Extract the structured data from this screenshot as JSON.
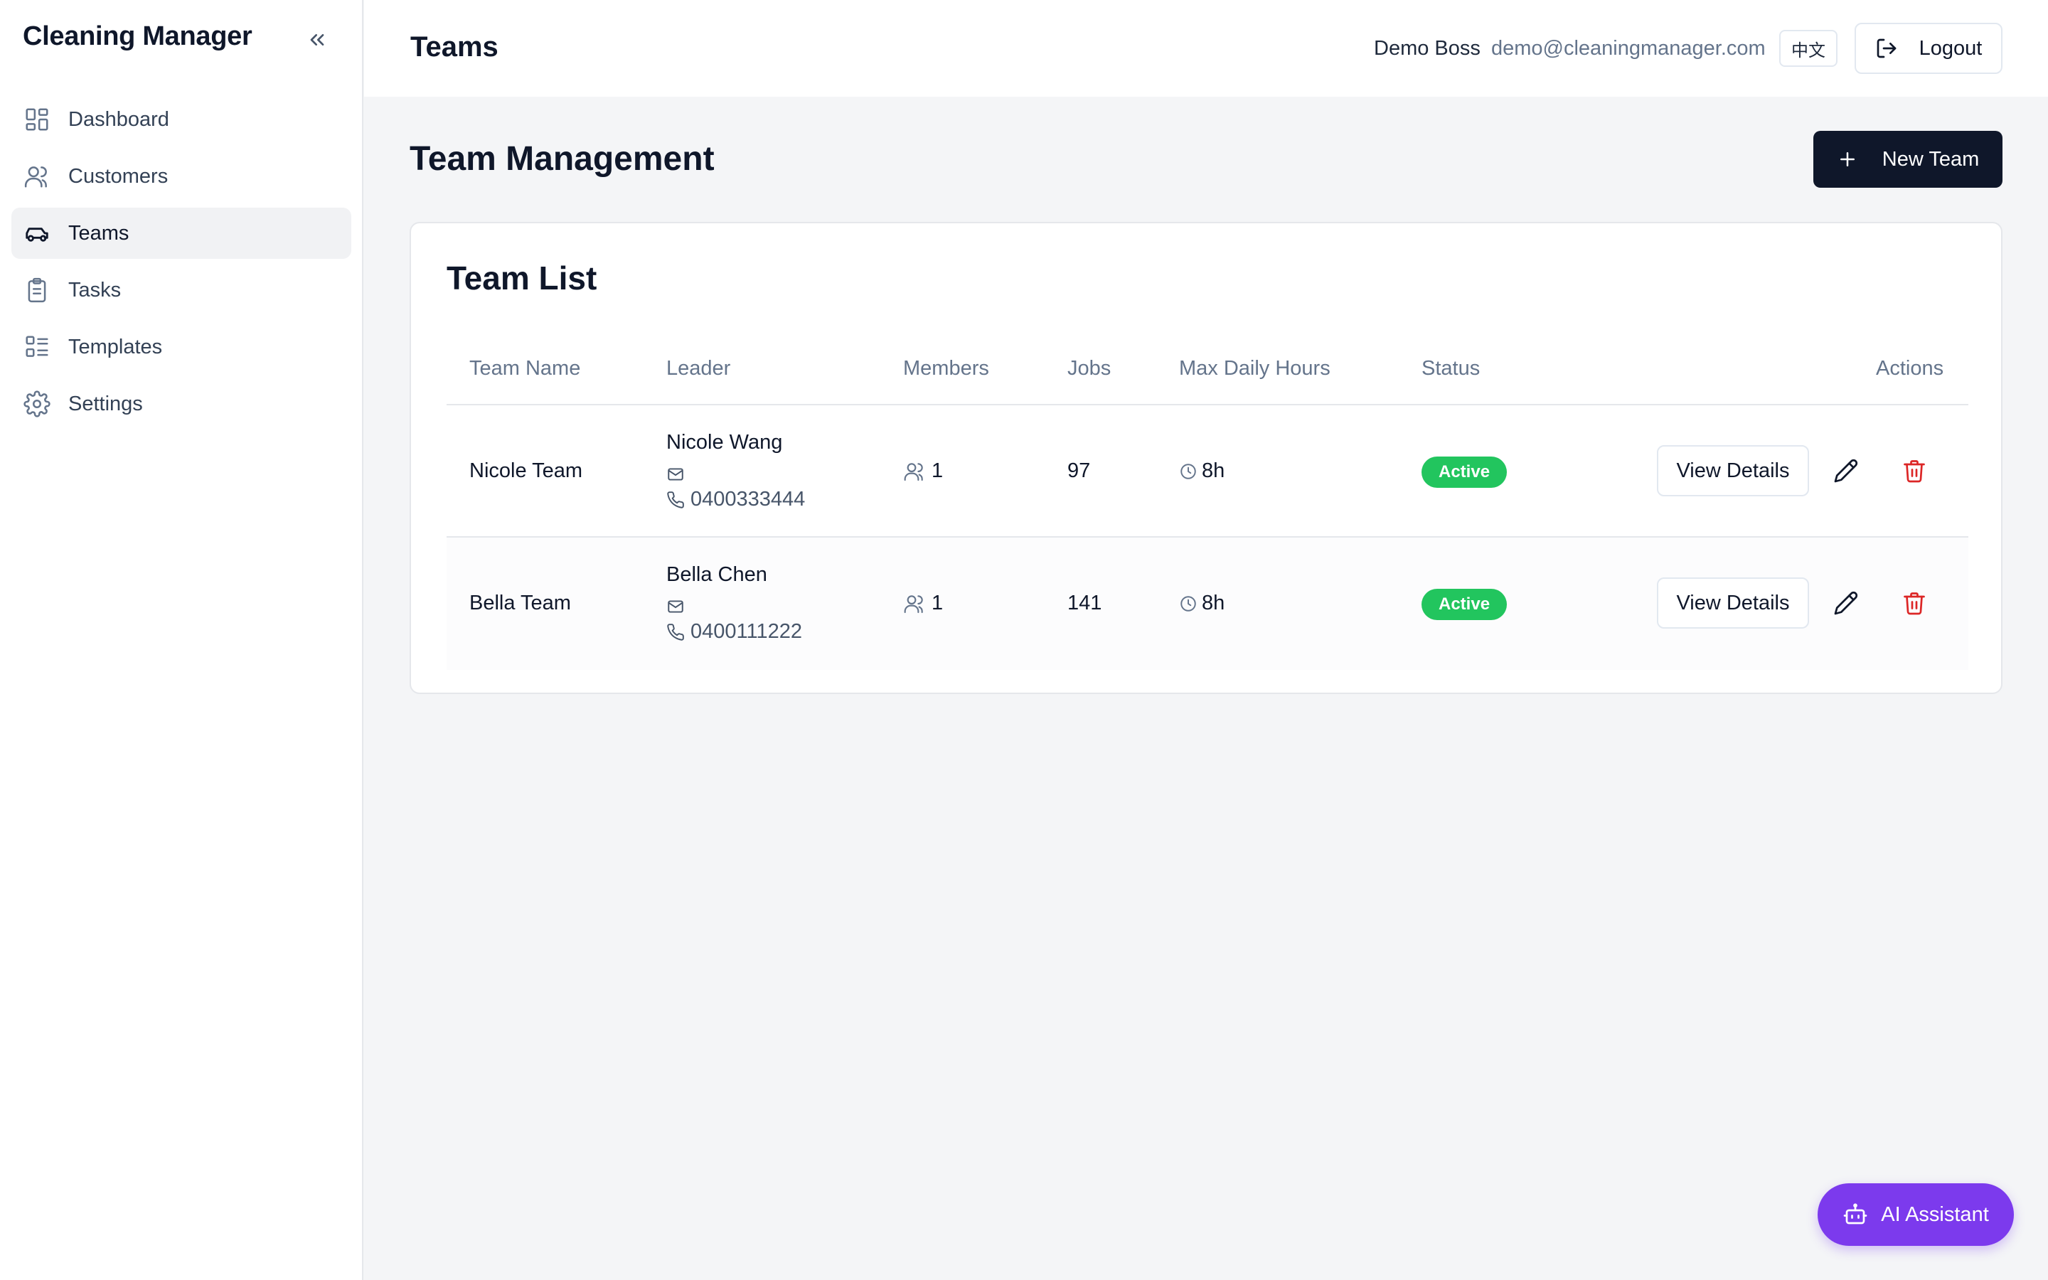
{
  "app": {
    "brand": "Cleaning Manager"
  },
  "sidebar": {
    "items": [
      {
        "label": "Dashboard",
        "icon": "dashboard-icon"
      },
      {
        "label": "Customers",
        "icon": "users-icon"
      },
      {
        "label": "Teams",
        "icon": "car-icon",
        "active": true
      },
      {
        "label": "Tasks",
        "icon": "clipboard-icon"
      },
      {
        "label": "Templates",
        "icon": "list-icon"
      },
      {
        "label": "Settings",
        "icon": "gear-icon"
      }
    ]
  },
  "header": {
    "title": "Teams",
    "user_name": "Demo Boss",
    "user_email": "demo@cleaningmanager.com",
    "lang_label": "中文",
    "logout_label": "Logout"
  },
  "main": {
    "page_title": "Team Management",
    "new_team_label": "New Team",
    "card_title": "Team List",
    "columns": [
      "Team Name",
      "Leader",
      "Members",
      "Jobs",
      "Max Daily Hours",
      "Status",
      "Actions"
    ],
    "rows": [
      {
        "team_name": "Nicole Team",
        "leader_name": "Nicole Wang",
        "leader_phone": "0400333444",
        "members": "1",
        "jobs": "97",
        "max_hours": "8h",
        "status": "Active",
        "view_label": "View Details"
      },
      {
        "team_name": "Bella Team",
        "leader_name": "Bella Chen",
        "leader_phone": "0400111222",
        "members": "1",
        "jobs": "141",
        "max_hours": "8h",
        "status": "Active",
        "view_label": "View Details"
      }
    ]
  },
  "ai_assistant": {
    "label": "AI Assistant"
  },
  "colors": {
    "primary_dark": "#0f172a",
    "status_active": "#22c55e",
    "danger": "#dc2626",
    "ai_purple": "#7c3aed"
  }
}
